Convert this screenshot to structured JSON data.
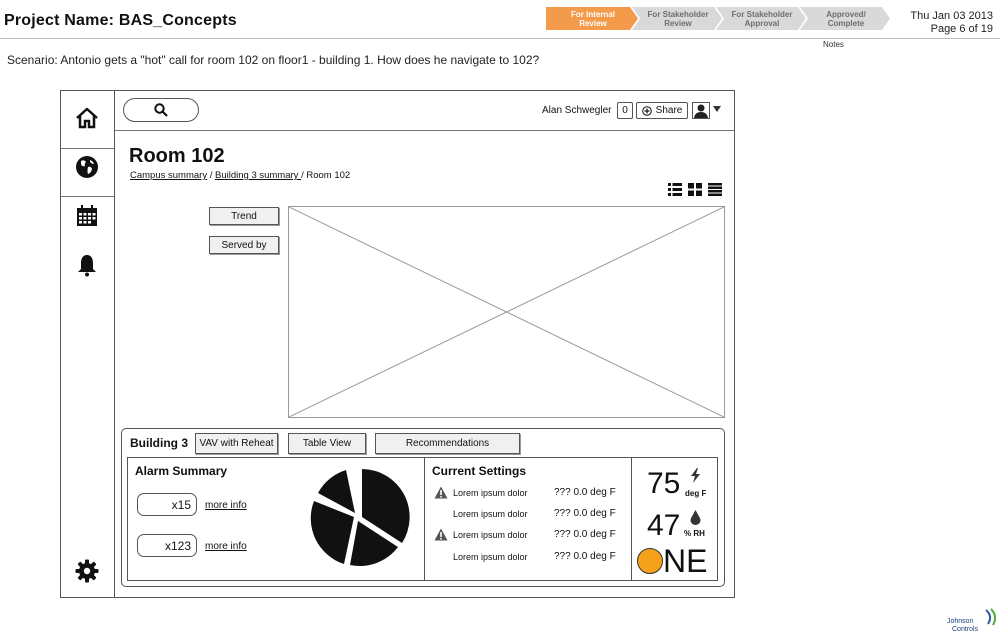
{
  "header": {
    "project_title": "Project Name: BAS_Concepts",
    "steps": [
      {
        "label": "For Internal Review",
        "state": "active"
      },
      {
        "label": "For Stakeholder Review",
        "state": "pending"
      },
      {
        "label": "For Stakeholder Approval",
        "state": "pending"
      },
      {
        "label": "Approved/ Complete",
        "state": "pending"
      }
    ],
    "date": "Thu Jan 03 2013",
    "page": "Page 6 of 19",
    "notes_label": "Notes",
    "accent_color": "#f39a4b"
  },
  "scenario": "Scenario: Antonio gets a \"hot\" call for room 102 on floor1 - building 1. How does he navigate to 102?",
  "sidebar": {
    "items": [
      {
        "icon": "home-icon"
      },
      {
        "icon": "globe-icon"
      },
      {
        "icon": "calendar-icon"
      },
      {
        "icon": "bell-icon"
      },
      {
        "icon": "gear-icon"
      }
    ]
  },
  "topbar": {
    "search_icon": "search-icon",
    "user_name": "Alan Schwegler",
    "notification_count": "0",
    "share_label": "Share"
  },
  "page": {
    "title": "Room 102",
    "breadcrumb": {
      "campus": "Campus summary",
      "building": "Building 3 summary ",
      "current": "Room 102",
      "separator": "/"
    },
    "view_icons": [
      "list-view-icon",
      "grid-view-icon",
      "compact-list-icon"
    ],
    "buttons": {
      "trend": "Trend",
      "served_by": "Served by"
    }
  },
  "building_panel": {
    "label": "Building 3",
    "tabs": [
      "VAV with Reheat",
      "Table View",
      "Recommendations"
    ],
    "alarm_summary": {
      "title": "Alarm Summary",
      "items": [
        {
          "count": "x15",
          "link": "more info"
        },
        {
          "count": "x123",
          "link": "more info"
        }
      ]
    },
    "current_settings": {
      "title": "Current Settings",
      "rows": [
        {
          "label": "Lorem ipsum dolor",
          "value": "??? 0.0 deg F",
          "warning": true
        },
        {
          "label": "Lorem ipsum dolor",
          "value": "??? 0.0 deg F",
          "warning": false
        },
        {
          "label": "Lorem ipsum dolor",
          "value": "??? 0.0 deg F",
          "warning": true
        },
        {
          "label": "Lorem ipsum dolor",
          "value": "??? 0.0 deg F",
          "warning": false
        }
      ]
    },
    "weather": {
      "temperature": "75",
      "temp_unit": "deg F",
      "humidity": "47",
      "humidity_unit": "% RH",
      "wind_direction": "NE"
    }
  },
  "footer": {
    "logo_line1": "Johnson",
    "logo_line2": "Controls"
  }
}
